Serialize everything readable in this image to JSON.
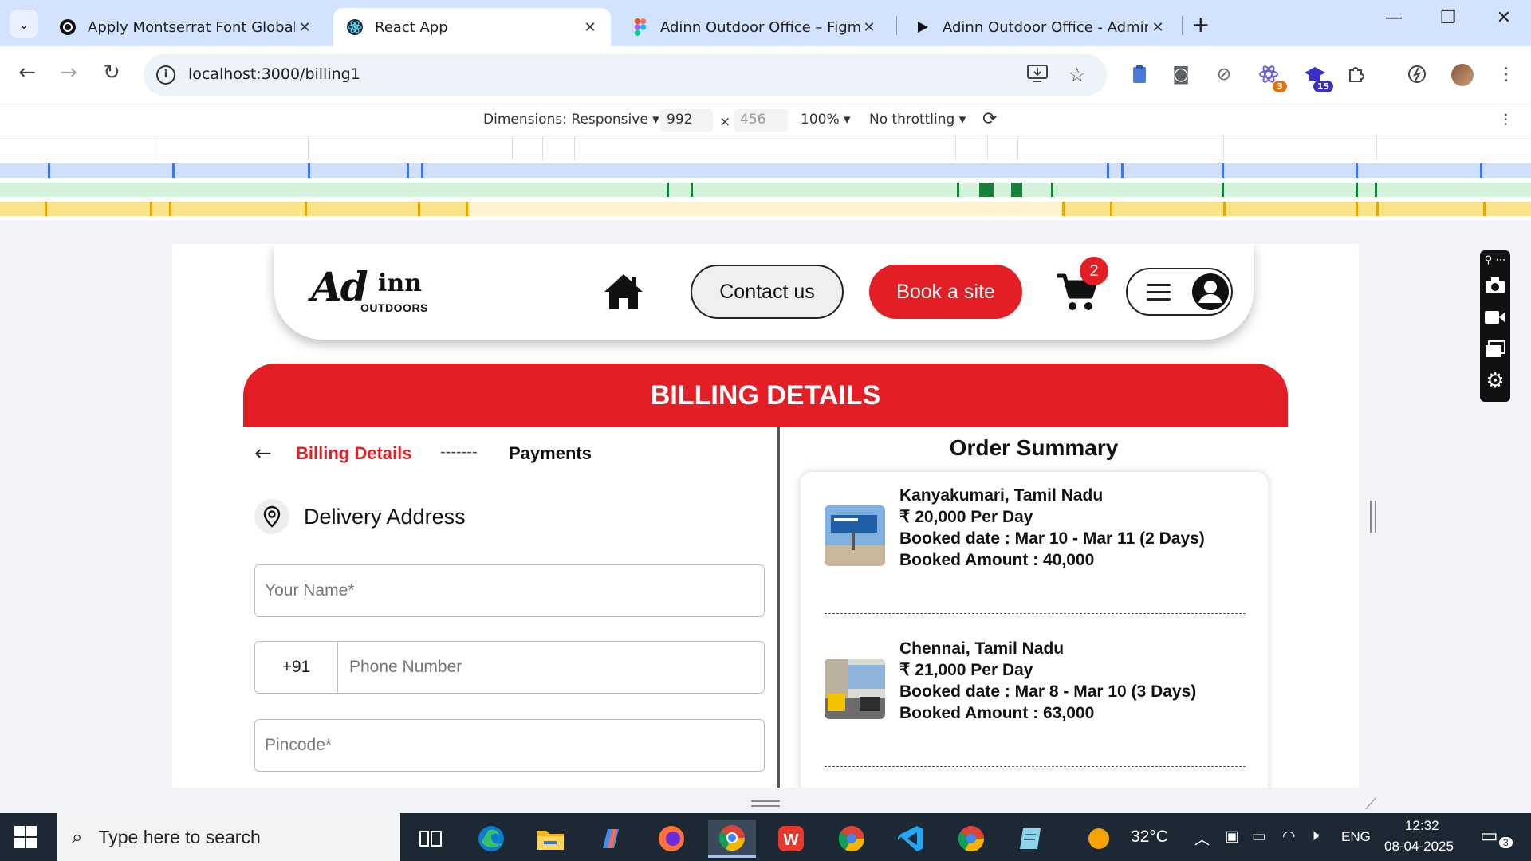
{
  "browser": {
    "tabs": [
      {
        "title": "Apply Montserrat Font Globally",
        "active": false
      },
      {
        "title": "React App",
        "active": true
      },
      {
        "title": "Adinn Outdoor Office – Figma",
        "active": false
      },
      {
        "title": "Adinn Outdoor Office - Admin p",
        "active": false
      }
    ],
    "url": "localhost:3000/billing1",
    "ext_badges": {
      "first": "3",
      "second": "15"
    }
  },
  "devtools": {
    "dimensions_label": "Dimensions: Responsive",
    "width": "992",
    "height": "456",
    "zoom": "100%",
    "throttling": "No throttling"
  },
  "site": {
    "nav": {
      "logo_ad": "Ad",
      "logo_inn": "inn",
      "logo_outdoors": "OUTDOORS",
      "contact_label": "Contact us",
      "book_label": "Book a site",
      "cart_count": "2"
    },
    "billing_title": "BILLING DETAILS",
    "steps": {
      "active": "Billing Details",
      "separator": "-------",
      "next": "Payments"
    },
    "address": {
      "title": "Delivery Address",
      "name_placeholder": "Your Name*",
      "phone_code": "+91",
      "phone_placeholder": "Phone Number",
      "pincode_placeholder": "Pincode*"
    },
    "summary": {
      "title": "Order Summary",
      "items": [
        {
          "location": "Kanyakumari, Tamil Nadu",
          "price": "₹ 20,000 Per Day",
          "booked_date": "Booked date : Mar 10 - Mar 11 (2 Days)",
          "booked_amount": "Booked Amount : 40,000"
        },
        {
          "location": "Chennai, Tamil Nadu",
          "price": "₹ 21,000 Per Day",
          "booked_date": "Booked date : Mar 8 - Mar 10 (3 Days)",
          "booked_amount": "Booked Amount : 63,000"
        }
      ]
    }
  },
  "taskbar": {
    "search_placeholder": "Type here to search",
    "weather": "32°C",
    "language": "ENG",
    "time": "12:32",
    "date": "08-04-2025",
    "notifications": "3"
  },
  "colors": {
    "brand_red": "#e31e24",
    "chrome_tabstrip": "#d3e3fd",
    "taskbar": "#1c2833"
  }
}
